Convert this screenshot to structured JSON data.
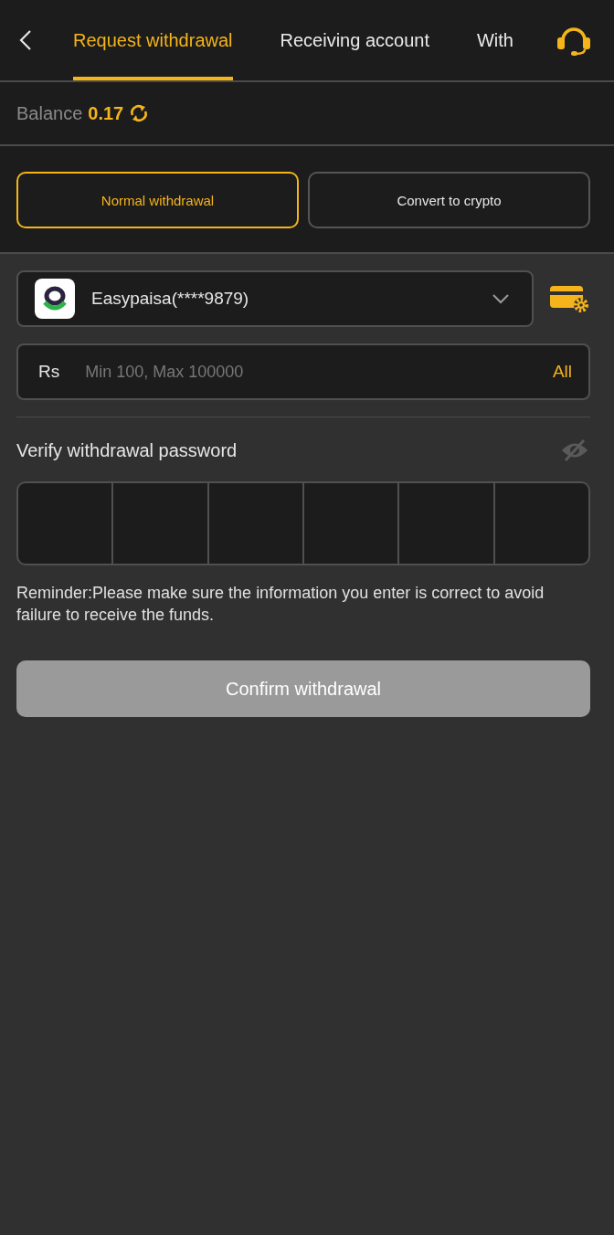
{
  "tabs": [
    {
      "label": "Request withdrawal",
      "selected": true
    },
    {
      "label": "Receiving account",
      "selected": false
    },
    {
      "label": "With",
      "selected": false
    }
  ],
  "balance": {
    "label": "Balance",
    "value": "0.17"
  },
  "modes": [
    {
      "label": "Normal withdrawal",
      "selected": true
    },
    {
      "label": "Convert to crypto",
      "selected": false
    }
  ],
  "account": {
    "value": "Easypaisa(****9879)"
  },
  "amount": {
    "currency": "Rs",
    "placeholder": "Min 100, Max 100000",
    "all_label": "All"
  },
  "password": {
    "label": "Verify withdrawal password",
    "visible": false,
    "boxes": [
      {
        "filled": false
      },
      {
        "filled": false
      },
      {
        "filled": false
      },
      {
        "filled": false
      },
      {
        "filled": false
      },
      {
        "filled": false
      }
    ]
  },
  "reminder": "Reminder:Please make sure the information you enter is correct to avoid failure to receive the funds.",
  "confirm": {
    "label": "Confirm withdrawal",
    "disabled": true
  }
}
